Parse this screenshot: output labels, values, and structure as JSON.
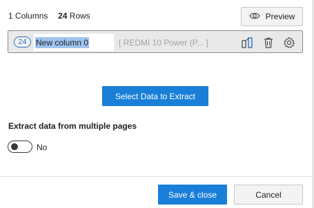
{
  "summary": {
    "columns_count": "1",
    "columns_label": "Columns",
    "rows_count": "24",
    "rows_label": "Rows"
  },
  "preview_button": {
    "label": "Preview",
    "icon": "eye-icon"
  },
  "column": {
    "count": "24",
    "name": "New column 0",
    "sample_value": "[ REDMI 10 Power (P...  ]",
    "actions": [
      "column-type-icon",
      "trash-icon",
      "gear-icon"
    ]
  },
  "select_data_button": {
    "label": "Select Data to Extract"
  },
  "multiple_pages": {
    "label": "Extract data from multiple pages",
    "toggle_state": "off",
    "toggle_text": "No"
  },
  "footer": {
    "save_label": "Save & close",
    "cancel_label": "Cancel"
  },
  "colors": {
    "accent": "#1a7fd8",
    "badge": "#2f6fc4",
    "selection": "#9fc3ee"
  }
}
